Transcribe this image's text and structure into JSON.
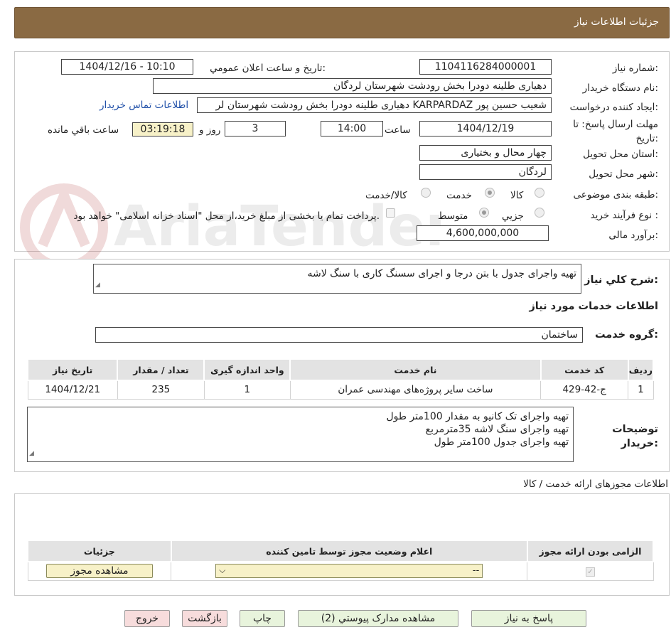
{
  "header": {
    "title": "جزئیات اطلاعات نیاز"
  },
  "watermark": {
    "text": "AriaTender.net"
  },
  "form": {
    "need_number_label": "شماره نیاز:",
    "need_number": "1104116284000001",
    "announce_label": "تاریخ و ساعت اعلان عمومي:",
    "announce_value": "1404/12/16 - 10:10",
    "buyer_org_label": "نام دستگاه خریدار:",
    "buyer_org": "دهیاری طلینه دودرا بخش رودشت شهرستان لردگان",
    "requester_label": "ایجاد کننده درخواست:",
    "requester": "شعیب حسین پور KARPARDAZ دهیاری طلینه دودرا بخش رودشت شهرستان لر",
    "contact_link": "اطلاعات تماس خریدار",
    "deadline_label": "مهلت ارسال پاسخ: تا تاریخ:",
    "deadline_date": "1404/12/19",
    "time_label": "ساعت",
    "deadline_time": "14:00",
    "days_value": "3",
    "days_label": "روز و",
    "remaining_value": "03:19:18",
    "remaining_label": "ساعت باقي مانده",
    "province_label": "استان محل تحویل:",
    "province": "چهار محال و بختیاری",
    "city_label": "شهر محل تحویل:",
    "city": "لردگان",
    "category_label": "طبقه بندی موضوعی:",
    "category_options": [
      "کالا",
      "خدمت",
      "کالا/خدمت"
    ],
    "process_label": "نوع فرآیند خرید :",
    "process_options": [
      "جزیي",
      "متوسط"
    ],
    "payment_note": "پرداخت تمام یا بخشی از مبلغ خرید،از محل \"اسناد خزانه اسلامی\" خواهد بود.",
    "budget_label": "برآورد مالی:",
    "budget": "4,600,000,000"
  },
  "description": {
    "label": "شرح کلي نیاز:",
    "text": "تهیه واجرای جدول  با بتن درجا  و اجرای سسنگ کاری با سنگ لاشه"
  },
  "services": {
    "title": "اطلاعات خدمات مورد نیاز",
    "group_label": "گروه خدمت:",
    "group_value": "ساختمان",
    "columns": [
      "ردیف",
      "کد خدمت",
      "نام خدمت",
      "واحد اندازه گیری",
      "تعداد / مقدار",
      "تاریخ نیاز"
    ],
    "rows": [
      {
        "row": "1",
        "code": "ج-42-429",
        "name": "ساخت سایر پروژه‌های مهندسی عمران",
        "unit": "1",
        "qty": "235",
        "date": "1404/12/21"
      }
    ]
  },
  "buyer_notes": {
    "label": "توضیحات خریدار:",
    "lines": [
      "تهیه واجرای تک کانیو به مقدار 100متر طول",
      "تهیه واجرای سنگ لاشه 35مترمربع",
      "تهیه واجرای جدول 100متر طول"
    ]
  },
  "permits": {
    "title": "اطلاعات مجوزهای ارائه خدمت / کالا",
    "columns": [
      "الزامی بودن ارائه مجوز",
      "اعلام وضعیت مجوز توسط تامین کننده",
      "جزئیات"
    ],
    "select_value": "--",
    "view_button": "مشاهده مجوز"
  },
  "buttons": {
    "reply": "پاسخ به نیاز",
    "attachments": "مشاهده مدارک پیوستي (2)",
    "print": "چاپ",
    "back": "بازگشت",
    "exit": "خروج"
  }
}
